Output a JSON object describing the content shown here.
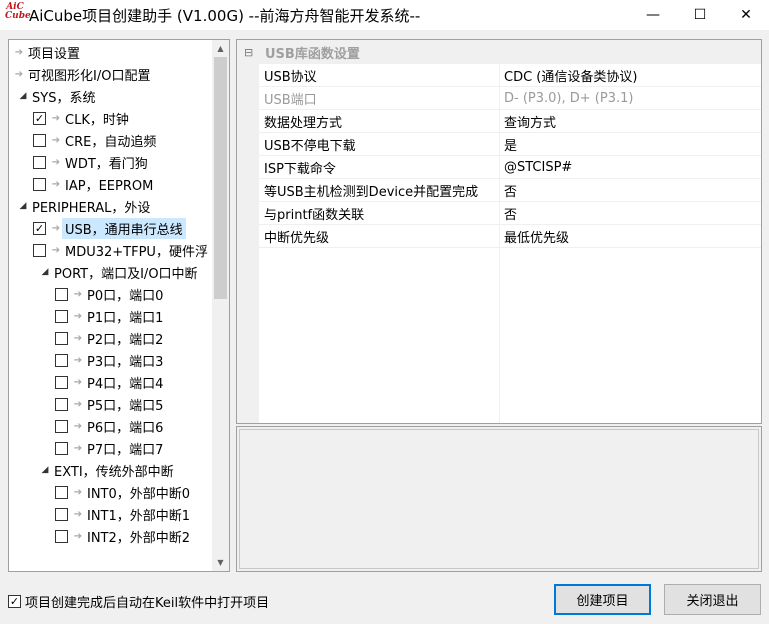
{
  "window": {
    "logo_text": "AiC Cube",
    "title": "AiCube项目创建助手 (V1.00G) --前海方舟智能开发系统--",
    "minimize_glyph": "—",
    "maximize_glyph": "☐",
    "close_glyph": "✕"
  },
  "tree": {
    "items": [
      {
        "label": "项目设置",
        "arrow": "➔"
      },
      {
        "label": "可视图形化I/O口配置",
        "arrow": "➔"
      },
      {
        "label": "SYS，系统",
        "expand": "◢"
      },
      {
        "label": "CLK，时钟",
        "checked": true,
        "check_glyph": "✓"
      },
      {
        "label": "CRE，自动追频",
        "checked": false
      },
      {
        "label": "WDT，看门狗",
        "checked": false
      },
      {
        "label": "IAP，EEPROM",
        "checked": false
      },
      {
        "label": "PERIPHERAL，外设",
        "expand": "◢"
      },
      {
        "label": "USB，通用串行总线",
        "checked": true,
        "check_glyph": "✓",
        "selected": true
      },
      {
        "label": "MDU32+TFPU，硬件浮",
        "checked": false
      },
      {
        "label": "PORT，端口及I/O口中断",
        "expand": "◢"
      },
      {
        "label": "P0口，端口0",
        "checked": false
      },
      {
        "label": "P1口，端口1",
        "checked": false
      },
      {
        "label": "P2口，端口2",
        "checked": false
      },
      {
        "label": "P3口，端口3",
        "checked": false
      },
      {
        "label": "P4口，端口4",
        "checked": false
      },
      {
        "label": "P5口，端口5",
        "checked": false
      },
      {
        "label": "P6口，端口6",
        "checked": false
      },
      {
        "label": "P7口，端口7",
        "checked": false
      },
      {
        "label": "EXTI，传统外部中断",
        "expand": "◢"
      },
      {
        "label": "INT0，外部中断0",
        "checked": false
      },
      {
        "label": "INT1，外部中断1",
        "checked": false
      },
      {
        "label": "INT2，外部中断2",
        "checked": false
      }
    ],
    "scroll_up": "▲",
    "scroll_down": "▼"
  },
  "properties": {
    "collapse_glyph": "⊟",
    "header": "USB库函数设置",
    "rows": [
      {
        "key": "USB协议",
        "value": "CDC (通信设备类协议)"
      },
      {
        "key": "USB端口",
        "value": "D- (P3.0), D+ (P3.1)",
        "disabled": true
      },
      {
        "key": "数据处理方式",
        "value": "查询方式"
      },
      {
        "key": "USB不停电下载",
        "value": "是"
      },
      {
        "key": "ISP下载命令",
        "value": "@STCISP#"
      },
      {
        "key": "等USB主机检测到Device并配置完成",
        "value": "否"
      },
      {
        "key": "与printf函数关联",
        "value": "否"
      },
      {
        "key": "中断优先级",
        "value": "最低优先级"
      }
    ]
  },
  "footer": {
    "auto_open_label": "项目创建完成后自动在Keil软件中打开项目",
    "auto_open_checked": true,
    "check_glyph": "✓",
    "create_button": "创建项目",
    "close_button": "关闭退出"
  }
}
